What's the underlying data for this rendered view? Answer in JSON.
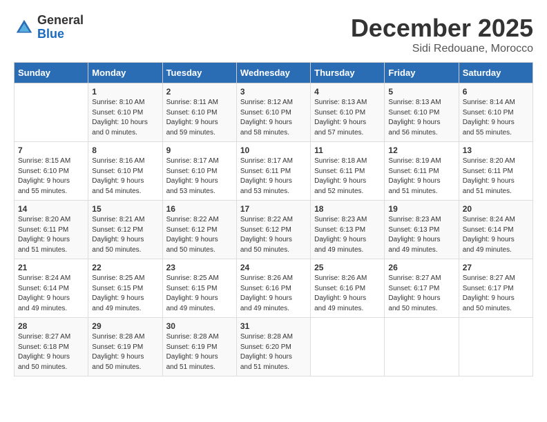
{
  "logo": {
    "general": "General",
    "blue": "Blue"
  },
  "title": "December 2025",
  "subtitle": "Sidi Redouane, Morocco",
  "days_header": [
    "Sunday",
    "Monday",
    "Tuesday",
    "Wednesday",
    "Thursday",
    "Friday",
    "Saturday"
  ],
  "weeks": [
    [
      {
        "day": "",
        "info": ""
      },
      {
        "day": "1",
        "info": "Sunrise: 8:10 AM\nSunset: 6:10 PM\nDaylight: 10 hours\nand 0 minutes."
      },
      {
        "day": "2",
        "info": "Sunrise: 8:11 AM\nSunset: 6:10 PM\nDaylight: 9 hours\nand 59 minutes."
      },
      {
        "day": "3",
        "info": "Sunrise: 8:12 AM\nSunset: 6:10 PM\nDaylight: 9 hours\nand 58 minutes."
      },
      {
        "day": "4",
        "info": "Sunrise: 8:13 AM\nSunset: 6:10 PM\nDaylight: 9 hours\nand 57 minutes."
      },
      {
        "day": "5",
        "info": "Sunrise: 8:13 AM\nSunset: 6:10 PM\nDaylight: 9 hours\nand 56 minutes."
      },
      {
        "day": "6",
        "info": "Sunrise: 8:14 AM\nSunset: 6:10 PM\nDaylight: 9 hours\nand 55 minutes."
      }
    ],
    [
      {
        "day": "7",
        "info": "Sunrise: 8:15 AM\nSunset: 6:10 PM\nDaylight: 9 hours\nand 55 minutes."
      },
      {
        "day": "8",
        "info": "Sunrise: 8:16 AM\nSunset: 6:10 PM\nDaylight: 9 hours\nand 54 minutes."
      },
      {
        "day": "9",
        "info": "Sunrise: 8:17 AM\nSunset: 6:10 PM\nDaylight: 9 hours\nand 53 minutes."
      },
      {
        "day": "10",
        "info": "Sunrise: 8:17 AM\nSunset: 6:11 PM\nDaylight: 9 hours\nand 53 minutes."
      },
      {
        "day": "11",
        "info": "Sunrise: 8:18 AM\nSunset: 6:11 PM\nDaylight: 9 hours\nand 52 minutes."
      },
      {
        "day": "12",
        "info": "Sunrise: 8:19 AM\nSunset: 6:11 PM\nDaylight: 9 hours\nand 51 minutes."
      },
      {
        "day": "13",
        "info": "Sunrise: 8:20 AM\nSunset: 6:11 PM\nDaylight: 9 hours\nand 51 minutes."
      }
    ],
    [
      {
        "day": "14",
        "info": "Sunrise: 8:20 AM\nSunset: 6:11 PM\nDaylight: 9 hours\nand 51 minutes."
      },
      {
        "day": "15",
        "info": "Sunrise: 8:21 AM\nSunset: 6:12 PM\nDaylight: 9 hours\nand 50 minutes."
      },
      {
        "day": "16",
        "info": "Sunrise: 8:22 AM\nSunset: 6:12 PM\nDaylight: 9 hours\nand 50 minutes."
      },
      {
        "day": "17",
        "info": "Sunrise: 8:22 AM\nSunset: 6:12 PM\nDaylight: 9 hours\nand 50 minutes."
      },
      {
        "day": "18",
        "info": "Sunrise: 8:23 AM\nSunset: 6:13 PM\nDaylight: 9 hours\nand 49 minutes."
      },
      {
        "day": "19",
        "info": "Sunrise: 8:23 AM\nSunset: 6:13 PM\nDaylight: 9 hours\nand 49 minutes."
      },
      {
        "day": "20",
        "info": "Sunrise: 8:24 AM\nSunset: 6:14 PM\nDaylight: 9 hours\nand 49 minutes."
      }
    ],
    [
      {
        "day": "21",
        "info": "Sunrise: 8:24 AM\nSunset: 6:14 PM\nDaylight: 9 hours\nand 49 minutes."
      },
      {
        "day": "22",
        "info": "Sunrise: 8:25 AM\nSunset: 6:15 PM\nDaylight: 9 hours\nand 49 minutes."
      },
      {
        "day": "23",
        "info": "Sunrise: 8:25 AM\nSunset: 6:15 PM\nDaylight: 9 hours\nand 49 minutes."
      },
      {
        "day": "24",
        "info": "Sunrise: 8:26 AM\nSunset: 6:16 PM\nDaylight: 9 hours\nand 49 minutes."
      },
      {
        "day": "25",
        "info": "Sunrise: 8:26 AM\nSunset: 6:16 PM\nDaylight: 9 hours\nand 49 minutes."
      },
      {
        "day": "26",
        "info": "Sunrise: 8:27 AM\nSunset: 6:17 PM\nDaylight: 9 hours\nand 50 minutes."
      },
      {
        "day": "27",
        "info": "Sunrise: 8:27 AM\nSunset: 6:17 PM\nDaylight: 9 hours\nand 50 minutes."
      }
    ],
    [
      {
        "day": "28",
        "info": "Sunrise: 8:27 AM\nSunset: 6:18 PM\nDaylight: 9 hours\nand 50 minutes."
      },
      {
        "day": "29",
        "info": "Sunrise: 8:28 AM\nSunset: 6:19 PM\nDaylight: 9 hours\nand 50 minutes."
      },
      {
        "day": "30",
        "info": "Sunrise: 8:28 AM\nSunset: 6:19 PM\nDaylight: 9 hours\nand 51 minutes."
      },
      {
        "day": "31",
        "info": "Sunrise: 8:28 AM\nSunset: 6:20 PM\nDaylight: 9 hours\nand 51 minutes."
      },
      {
        "day": "",
        "info": ""
      },
      {
        "day": "",
        "info": ""
      },
      {
        "day": "",
        "info": ""
      }
    ]
  ]
}
